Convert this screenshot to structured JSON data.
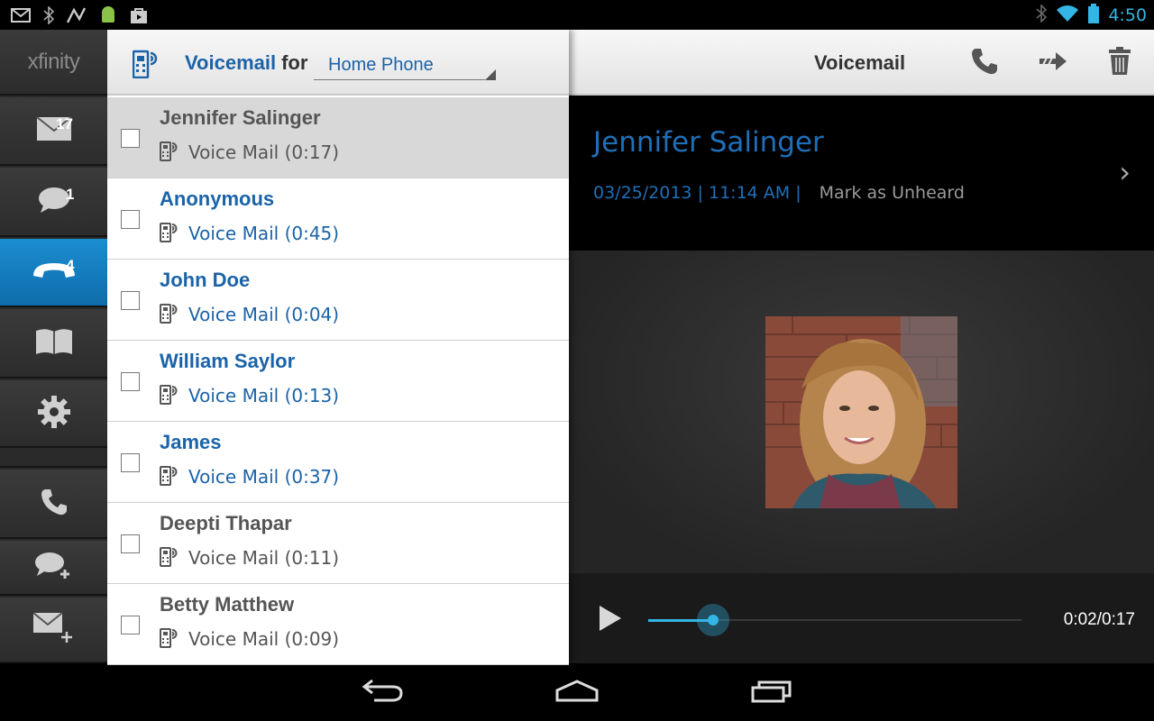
{
  "status_bar": {
    "time": "4:50",
    "left_icons": [
      "gmail-icon",
      "bluetooth-icon",
      "signal-tool-icon",
      "android-icon",
      "shopping-bag-icon"
    ],
    "right_icons": [
      "bluetooth-icon",
      "wifi-icon",
      "battery-icon"
    ]
  },
  "nav": {
    "brand": "xfinity",
    "items": [
      {
        "name": "messages",
        "icon": "envelope-icon",
        "badge": "17"
      },
      {
        "name": "text-messages",
        "icon": "chat-bubble-icon",
        "badge": "1"
      },
      {
        "name": "voicemail",
        "icon": "phone-handset-icon",
        "badge": "4",
        "active": true
      },
      {
        "name": "address-book",
        "icon": "book-icon",
        "badge": ""
      },
      {
        "name": "settings",
        "icon": "gear-icon",
        "badge": ""
      },
      {
        "name": "make-call",
        "icon": "phone-icon",
        "badge": ""
      },
      {
        "name": "new-text",
        "icon": "chat-add-icon",
        "badge": ""
      },
      {
        "name": "new-message",
        "icon": "envelope-add-icon",
        "badge": ""
      }
    ]
  },
  "list_header": {
    "title": "Voicemail",
    "for_label": "for",
    "selected_line": "Home Phone"
  },
  "voicemails": [
    {
      "name": "Jennifer Salinger",
      "label": "Voice Mail (0:17)",
      "state": "heard",
      "selected": true
    },
    {
      "name": "Anonymous",
      "label": "Voice Mail (0:45)",
      "state": "unheard",
      "selected": false
    },
    {
      "name": "John Doe",
      "label": "Voice Mail (0:04)",
      "state": "unheard",
      "selected": false
    },
    {
      "name": "William Saylor",
      "label": "Voice Mail (0:13)",
      "state": "unheard",
      "selected": false
    },
    {
      "name": "James",
      "label": "Voice Mail (0:37)",
      "state": "unheard",
      "selected": false
    },
    {
      "name": "Deepti Thapar",
      "label": "Voice Mail (0:11)",
      "state": "heard",
      "selected": false
    },
    {
      "name": "Betty Matthew",
      "label": "Voice Mail (0:09)",
      "state": "heard",
      "selected": false
    }
  ],
  "detail": {
    "title": "Voicemail",
    "actions": [
      "call-back-icon",
      "forward-icon",
      "trash-icon"
    ],
    "caller_name": "Jennifer Salinger",
    "date_time": "03/25/2013 | 11:14 AM |",
    "mark_label": "Mark as Unheard",
    "player": {
      "time": "0:02/0:17",
      "progress": 0.175
    }
  },
  "colors": {
    "accent_blue": "#1b63a8",
    "active_nav": "#1b8ed1",
    "progress": "#33b5e5"
  }
}
